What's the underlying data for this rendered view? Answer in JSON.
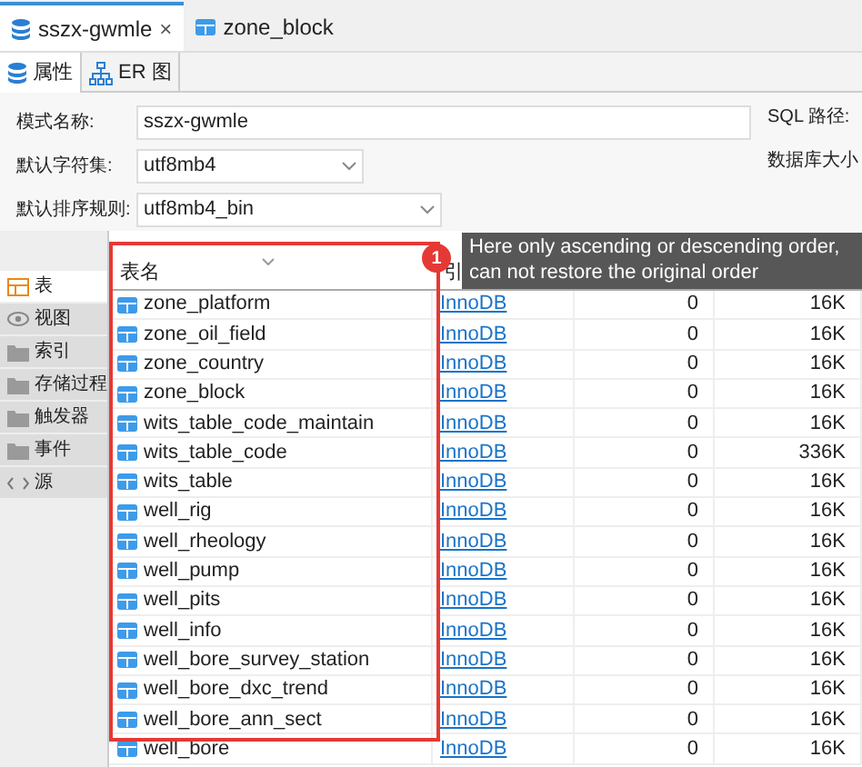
{
  "tabs": [
    {
      "label": "sszx-gwmle",
      "kind": "schema",
      "selected": true,
      "close": "×"
    },
    {
      "label": "zone_block",
      "kind": "table",
      "selected": false
    }
  ],
  "subtabs": [
    {
      "label": "属性",
      "kind": "schema",
      "selected": true
    },
    {
      "label": "ER 图",
      "kind": "er",
      "selected": false
    }
  ],
  "form": [
    {
      "label": "模式名称:",
      "kind": "input",
      "value": "sszx-gwmle",
      "side_label": "SQL 路径:"
    },
    {
      "label": "默认字符集:",
      "kind": "select",
      "value": "utf8mb4",
      "side_label": "数据库大小"
    },
    {
      "label": "默认排序规则:",
      "kind": "select",
      "value": "utf8mb4_bin"
    }
  ],
  "sidebar": {
    "items": [
      {
        "label": "表",
        "kind": "table",
        "selected": true
      },
      {
        "label": "视图",
        "kind": "view",
        "selected": false
      },
      {
        "label": "索引",
        "kind": "folder",
        "selected": false
      },
      {
        "label": "存储过程",
        "kind": "folder",
        "selected": false
      },
      {
        "label": "触发器",
        "kind": "folder",
        "selected": false
      },
      {
        "label": "事件",
        "kind": "folder",
        "selected": false
      },
      {
        "label": "源",
        "kind": "source",
        "selected": false
      }
    ]
  },
  "table": {
    "columns": [
      "表名",
      "引"
    ],
    "rows": [
      {
        "name": "zone_platform",
        "engine": "InnoDB",
        "rows": "0",
        "size": "16K"
      },
      {
        "name": "zone_oil_field",
        "engine": "InnoDB",
        "rows": "0",
        "size": "16K"
      },
      {
        "name": "zone_country",
        "engine": "InnoDB",
        "rows": "0",
        "size": "16K"
      },
      {
        "name": "zone_block",
        "engine": "InnoDB",
        "rows": "0",
        "size": "16K"
      },
      {
        "name": "wits_table_code_maintain",
        "engine": "InnoDB",
        "rows": "0",
        "size": "16K"
      },
      {
        "name": "wits_table_code",
        "engine": "InnoDB",
        "rows": "0",
        "size": "336K"
      },
      {
        "name": "wits_table",
        "engine": "InnoDB",
        "rows": "0",
        "size": "16K"
      },
      {
        "name": "well_rig",
        "engine": "InnoDB",
        "rows": "0",
        "size": "16K"
      },
      {
        "name": "well_rheology",
        "engine": "InnoDB",
        "rows": "0",
        "size": "16K"
      },
      {
        "name": "well_pump",
        "engine": "InnoDB",
        "rows": "0",
        "size": "16K"
      },
      {
        "name": "well_pits",
        "engine": "InnoDB",
        "rows": "0",
        "size": "16K"
      },
      {
        "name": "well_info",
        "engine": "InnoDB",
        "rows": "0",
        "size": "16K"
      },
      {
        "name": "well_bore_survey_station",
        "engine": "InnoDB",
        "rows": "0",
        "size": "16K"
      },
      {
        "name": "well_bore_dxc_trend",
        "engine": "InnoDB",
        "rows": "0",
        "size": "16K"
      },
      {
        "name": "well_bore_ann_sect",
        "engine": "InnoDB",
        "rows": "0",
        "size": "16K"
      },
      {
        "name": "well_bore",
        "engine": "InnoDB",
        "rows": "0",
        "size": "16K"
      }
    ]
  },
  "annotation": {
    "badge": "1",
    "tooltip": [
      "Here only ascending or descending order,",
      "can not restore the original order"
    ]
  }
}
